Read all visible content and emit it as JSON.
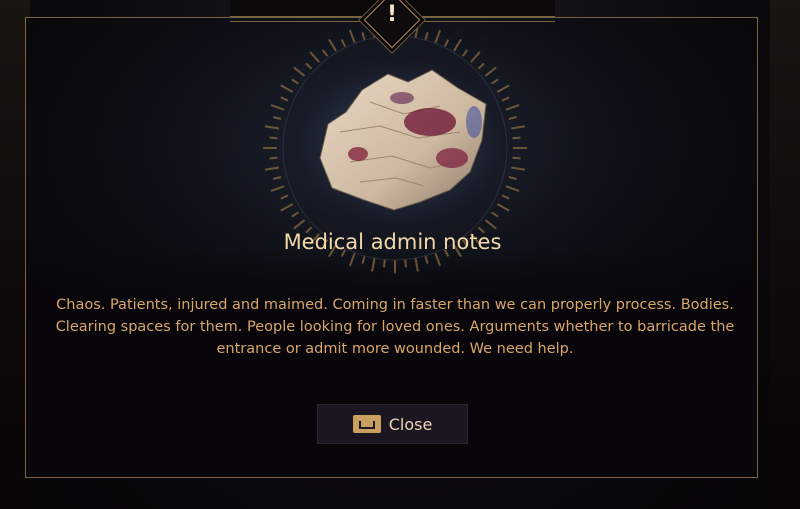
{
  "dialog": {
    "alert_glyph": "!",
    "title": "Medical admin notes",
    "body": "Chaos. Patients, injured and maimed. Coming in faster than we can properly process. Bodies. Clearing spaces for them. People looking for loved ones. Arguments whether to barricade the entrance or admit more wounded. We need help.",
    "close_label": "Close",
    "close_key_icon": "spacebar-key-icon"
  },
  "colors": {
    "accent_gold": "#b08a55",
    "title_text": "#f3d9a8",
    "body_text": "#d8a66a",
    "button_bg": "#1c1622"
  }
}
